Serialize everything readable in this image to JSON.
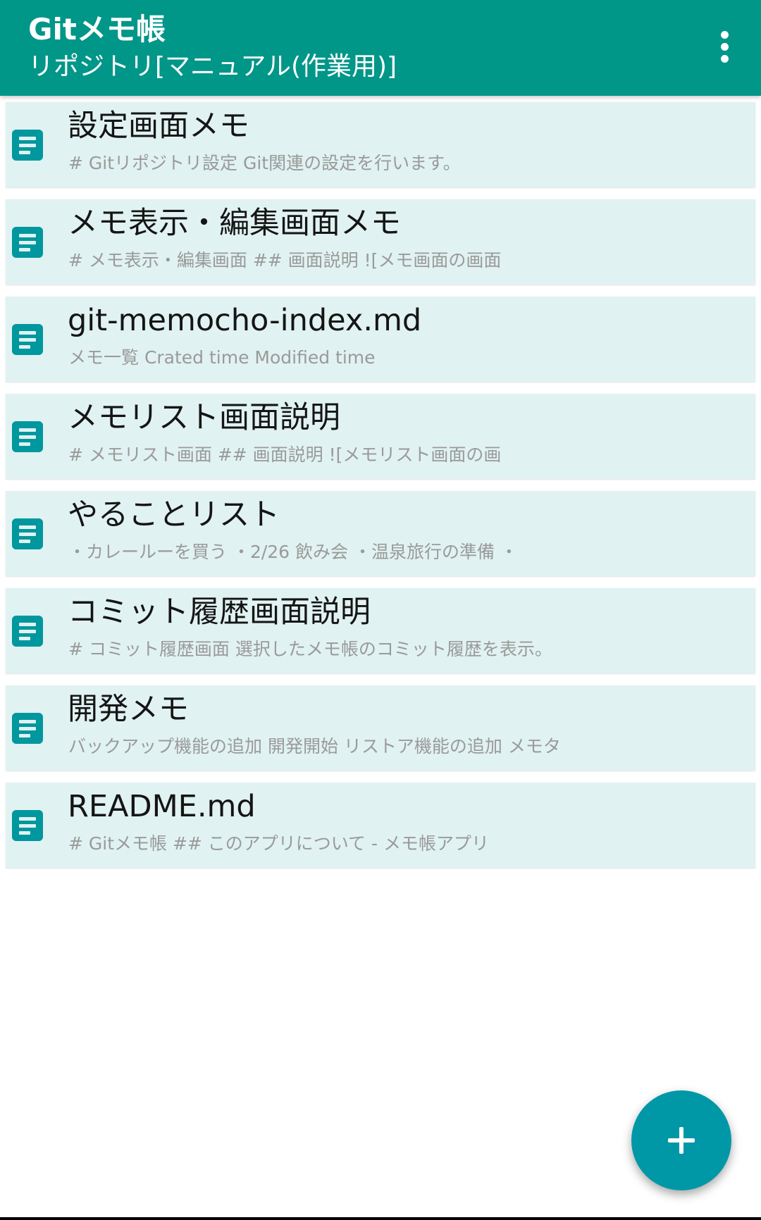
{
  "app_bar": {
    "title": "Gitメモ帳",
    "subtitle": "リポジトリ[マニュアル(作業用)]",
    "menu_icon": "more-vert-icon"
  },
  "memos": [
    {
      "title": "設定画面メモ",
      "preview": "# Gitリポジトリ設定 Git関連の設定を行います。",
      "icon": "document-icon"
    },
    {
      "title": "メモ表示・編集画面メモ",
      "preview": "# メモ表示・編集画面  ## 画面説明 ![メモ画面の画面",
      "icon": "document-icon"
    },
    {
      "title": "git-memocho-index.md",
      "preview": "メモ一覧 Crated time  Modified time",
      "icon": "document-icon"
    },
    {
      "title": "メモリスト画面説明",
      "preview": "# メモリスト画面  ## 画面説明 ![メモリスト画面の画",
      "icon": "document-icon"
    },
    {
      "title": "やることリスト",
      "preview": "・カレールーを買う ・2/26 飲み会 ・温泉旅行の準備 ・",
      "icon": "document-icon"
    },
    {
      "title": "コミット履歴画面説明",
      "preview": "# コミット履歴画面 選択したメモ帳のコミット履歴を表示。",
      "icon": "document-icon"
    },
    {
      "title": "開発メモ",
      "preview": "バックアップ機能の追加 開発開始 リストア機能の追加 メモタ",
      "icon": "document-icon"
    },
    {
      "title": "README.md",
      "preview": "# Gitメモ帳 ## このアプリについて - メモ帳アプリ",
      "icon": "document-icon"
    }
  ],
  "fab": {
    "icon": "plus-icon"
  },
  "colors": {
    "primary": "#009688",
    "item_background": "#e0f2f1",
    "icon": "#00979e",
    "fab": "#0097a7"
  }
}
